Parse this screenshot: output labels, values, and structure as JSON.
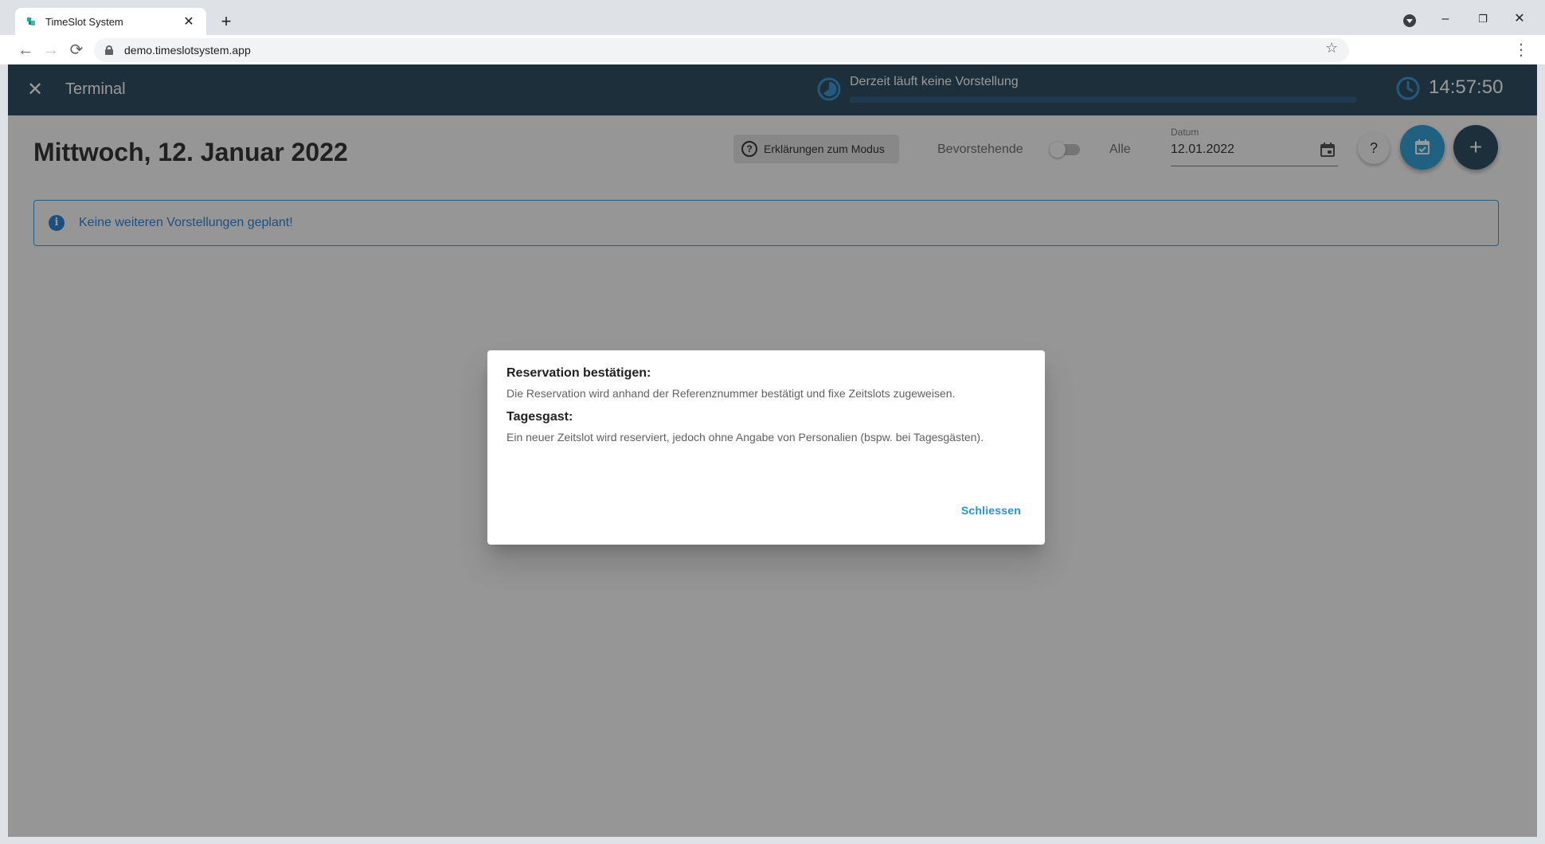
{
  "browser": {
    "tab_title": "TimeSlot System",
    "url": "demo.timeslotsystem.app",
    "new_tab_label": "+",
    "minimize_label": "–",
    "maximize_label": "❐",
    "close_label": "✕"
  },
  "appbar": {
    "title": "Terminal",
    "performance_status": "Derzeit läuft keine Vorstellung",
    "performance_progress": 0,
    "clock": "14:57:50",
    "accent_color": "#1a3b50"
  },
  "toolbar": {
    "date_heading": "Mittwoch, 12. Januar 2022",
    "explain_button": "Erklärungen zum Modus",
    "toggle_left_label": "Bevorstehende",
    "toggle_right_label": "Alle",
    "toggle_on": false,
    "date_field_label": "Datum",
    "date_field_value": "12.01.2022",
    "help_button": "?",
    "add_button": "+"
  },
  "alert": {
    "text": "Keine weiteren Vorstellungen geplant!"
  },
  "dialog": {
    "heading1": "Reservation bestätigen:",
    "text1": "Die Reservation wird anhand der Referenznummer bestätigt und fixe Zeitslots zugeweisen.",
    "heading2": "Tagesgast:",
    "text2": "Ein neuer Zeitslot wird reserviert, jedoch ohne Angabe von Personalien (bspw. bei Tagesgästen).",
    "close_button": "Schliessen"
  }
}
